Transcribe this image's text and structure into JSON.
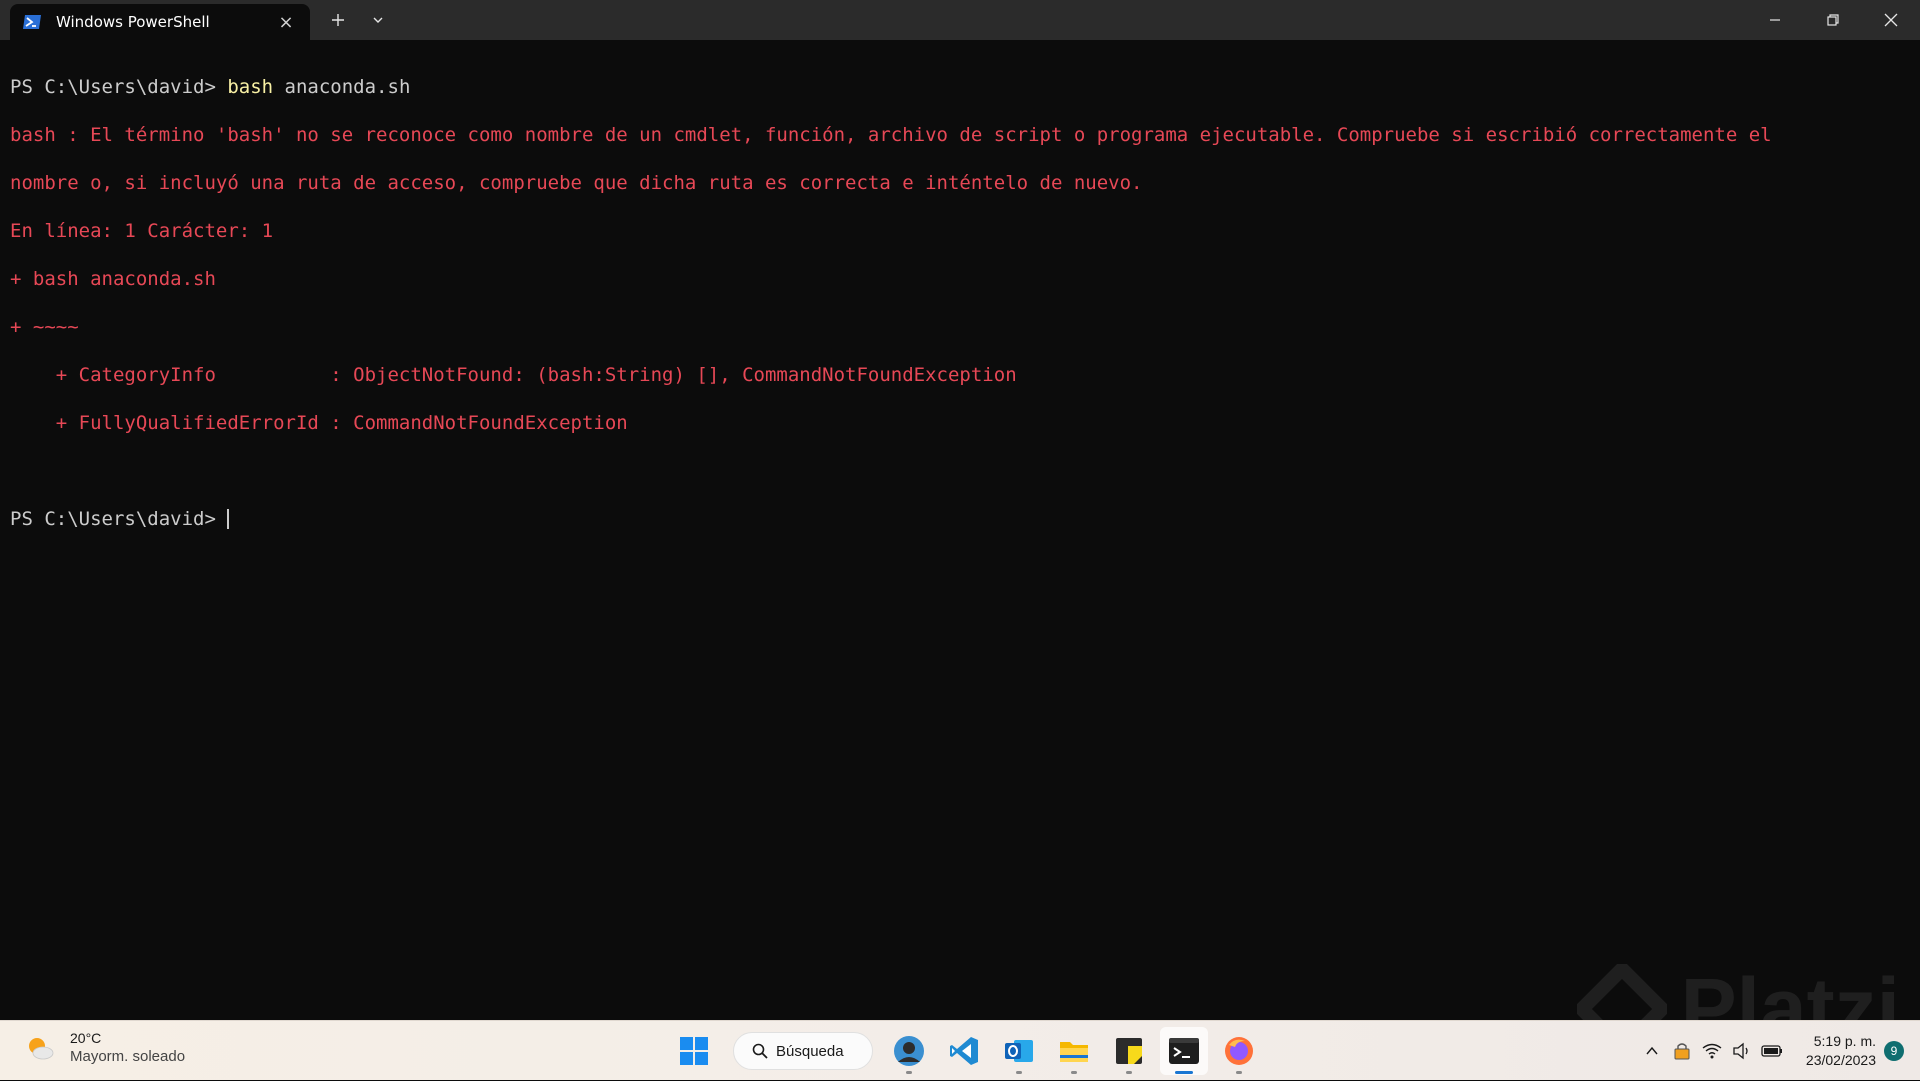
{
  "window": {
    "tab_title": "Windows PowerShell",
    "tab_icon": "powershell-icon",
    "close_tab_glyph": "×",
    "new_tab_icon": "plus-icon",
    "dropdown_icon": "chevron-down-icon",
    "controls": [
      "minimize-icon",
      "restore-icon",
      "close-icon"
    ]
  },
  "terminal": {
    "lines": [
      {
        "prompt": "PS C:\\Users\\david> ",
        "command": "bash",
        "args": " anaconda.sh"
      },
      {
        "text": "bash : El término 'bash' no se reconoce como nombre de un cmdlet, función, archivo de script o programa ejecutable. Compruebe si escribió correctamente el"
      },
      {
        "text": "nombre o, si incluyó una ruta de acceso, compruebe que dicha ruta es correcta e inténtelo de nuevo."
      },
      {
        "text": "En línea: 1 Carácter: 1"
      },
      {
        "text": "+ bash anaconda.sh"
      },
      {
        "text": "+ ~~~~"
      },
      {
        "text": "    + CategoryInfo          : ObjectNotFound: (bash:String) [], CommandNotFoundException"
      },
      {
        "text": "    + FullyQualifiedErrorId : CommandNotFoundException"
      },
      {
        "text": ""
      },
      {
        "prompt": "PS C:\\Users\\david> "
      }
    ],
    "colors": {
      "background": "#0c0c0c",
      "foreground": "#cccccc",
      "error": "#e74856",
      "command": "#f9f1a5"
    }
  },
  "watermark": {
    "text": "Platzi"
  },
  "taskbar": {
    "weather": {
      "temp": "20°C",
      "condition": "Mayorm. soleado",
      "icon": "partly-sunny-icon"
    },
    "search_label": "Búsqueda",
    "apps": [
      "windows-start-icon",
      "search-icon",
      "profile-photo-icon",
      "vscode-icon",
      "outlook-icon",
      "file-explorer-icon",
      "sticky-notes-icon",
      "terminal-icon",
      "firefox-icon"
    ],
    "tray_icons": [
      "chevron-up-icon",
      "vpn-lock-icon",
      "wifi-icon",
      "volume-icon",
      "battery-icon"
    ],
    "time": "5:19 p. m.",
    "date": "23/02/2023",
    "notification_count": "9"
  }
}
